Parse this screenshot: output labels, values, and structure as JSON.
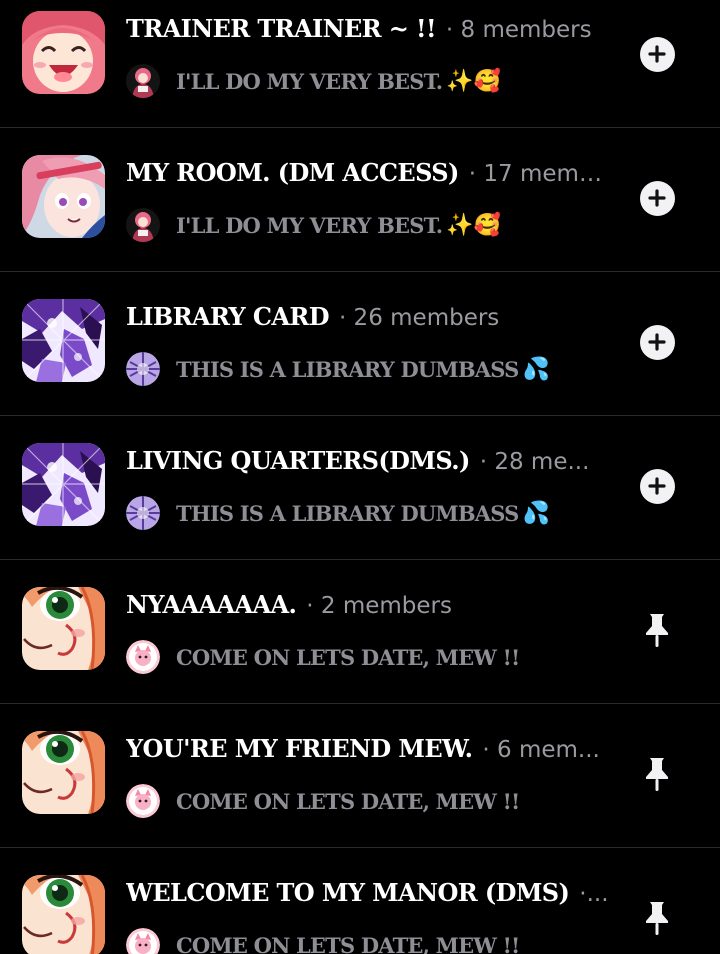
{
  "colors": {
    "background": "#000000",
    "divider": "#2a2a2d",
    "title": "#ffffff",
    "members": "#9a9aa0",
    "subtitle": "#8e8e95"
  },
  "chats": [
    {
      "title": "TRAINER TRAINER ~ !!",
      "members": "· 8 members",
      "subtitle": "I'LL DO MY VERY BEST.",
      "emoji": "✨🥰",
      "avatar": "pink-hair-laughing-avatar",
      "mini_avatar": "pink-character-mini-avatar",
      "action_icon": "plus-icon"
    },
    {
      "title": "MY ROOM. (DM ACCESS)",
      "members": "· 17 members",
      "subtitle": "I'LL DO MY VERY BEST.",
      "emoji": "✨🥰",
      "avatar": "pink-hair-girl-avatar",
      "mini_avatar": "pink-character-mini-avatar",
      "action_icon": "plus-icon"
    },
    {
      "title": "LIBRARY CARD",
      "members": "· 26 members",
      "subtitle": "THIS IS A LIBRARY DUMBASS",
      "emoji": "💦",
      "avatar": "purple-library-avatar",
      "mini_avatar": "purple-mini-avatar",
      "action_icon": "plus-icon"
    },
    {
      "title": "LIVING QUARTERS(DMS.)",
      "members": "· 28 me...",
      "subtitle": "THIS IS A LIBRARY DUMBASS",
      "emoji": "💦",
      "avatar": "purple-library-avatar",
      "mini_avatar": "purple-mini-avatar",
      "action_icon": "plus-icon"
    },
    {
      "title": "NYAAAAAAA.",
      "members": "· 2 members",
      "subtitle": "COME ON LETS DATE, MEW !!",
      "emoji": "",
      "avatar": "green-eye-face-avatar",
      "mini_avatar": "pink-cat-mini-avatar",
      "action_icon": "pin-icon"
    },
    {
      "title": "YOU'RE MY FRIEND MEW.",
      "members": "· 6 mem...",
      "subtitle": "COME ON LETS DATE, MEW !!",
      "emoji": "",
      "avatar": "green-eye-face-avatar",
      "mini_avatar": "pink-cat-mini-avatar",
      "action_icon": "pin-icon"
    },
    {
      "title": "WELCOME TO MY MANOR (DMS)",
      "members": "·...",
      "subtitle": "COME ON LETS DATE, MEW !!",
      "emoji": "",
      "avatar": "green-eye-face-avatar",
      "mini_avatar": "pink-cat-mini-avatar",
      "action_icon": "pin-icon"
    }
  ]
}
